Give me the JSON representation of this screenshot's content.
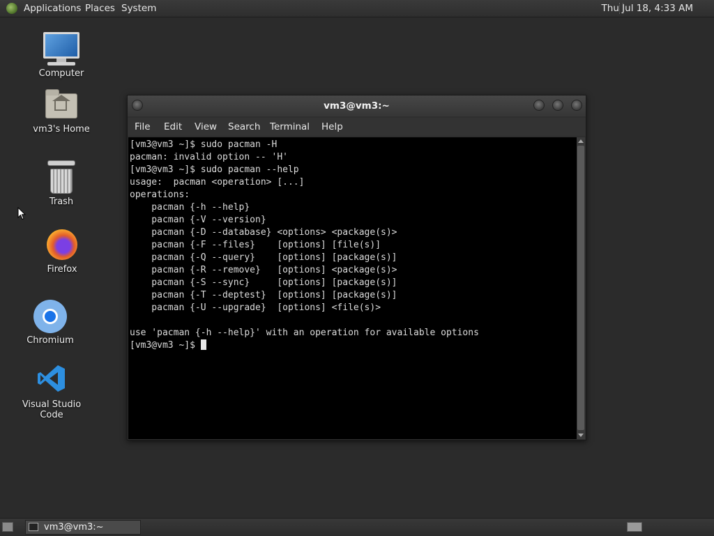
{
  "top_panel": {
    "menus": [
      "Applications",
      "Places",
      "System"
    ],
    "clock": "Thu Jul 18,  4:33 AM"
  },
  "desktop_icons": [
    {
      "label": "Computer",
      "icon": "computer-icon"
    },
    {
      "label": "vm3's Home",
      "icon": "home-folder-icon"
    },
    {
      "label": "Trash",
      "icon": "trash-icon"
    },
    {
      "label": "Firefox",
      "icon": "firefox-icon"
    },
    {
      "label": "Chromium",
      "icon": "chromium-icon"
    },
    {
      "label": "Visual Studio Code",
      "icon": "vscode-icon"
    }
  ],
  "terminal": {
    "title": "vm3@vm3:~",
    "menu": [
      "File",
      "Edit",
      "View",
      "Search",
      "Terminal",
      "Help"
    ],
    "lines": [
      "[vm3@vm3 ~]$ sudo pacman -H",
      "pacman: invalid option -- 'H'",
      "[vm3@vm3 ~]$ sudo pacman --help",
      "usage:  pacman <operation> [...]",
      "operations:",
      "    pacman {-h --help}",
      "    pacman {-V --version}",
      "    pacman {-D --database} <options> <package(s)>",
      "    pacman {-F --files}    [options] [file(s)]",
      "    pacman {-Q --query}    [options] [package(s)]",
      "    pacman {-R --remove}   [options] <package(s)>",
      "    pacman {-S --sync}     [options] [package(s)]",
      "    pacman {-T --deptest}  [options] [package(s)]",
      "    pacman {-U --upgrade}  [options] <file(s)>",
      "",
      "use 'pacman {-h --help}' with an operation for available options"
    ],
    "prompt": "[vm3@vm3 ~]$ "
  },
  "taskbar": {
    "task_label": "vm3@vm3:~"
  },
  "colors": {
    "desktop_bg": "#2b2b2b",
    "terminal_bg": "#000000",
    "terminal_fg": "#dcdcdc"
  }
}
